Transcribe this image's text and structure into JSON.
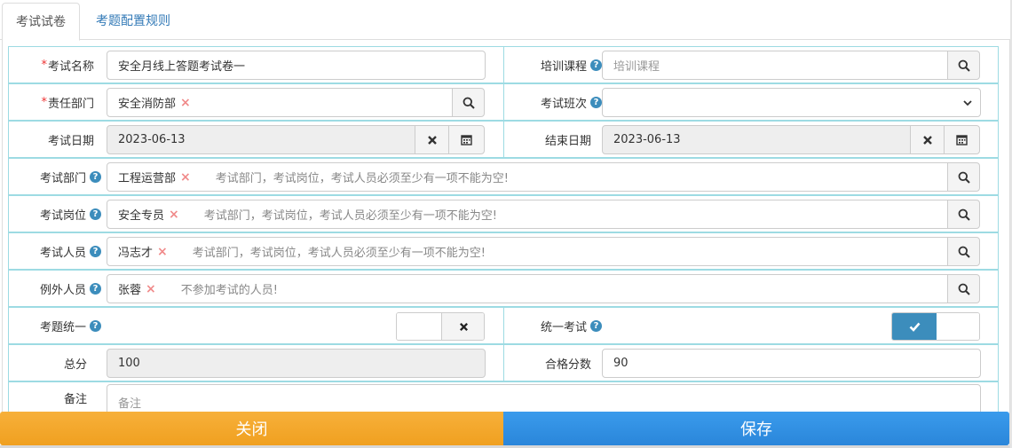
{
  "tabs": [
    {
      "label": "考试试卷"
    },
    {
      "label": "考题配置规则"
    }
  ],
  "form": {
    "exam_name": {
      "required_mark": "*",
      "label": "考试名称",
      "value": "安全月线上答题考试卷一"
    },
    "training_course": {
      "label": "培训课程",
      "placeholder": "培训课程"
    },
    "responsible_dept": {
      "required_mark": "*",
      "label": "责任部门",
      "tag": "安全消防部"
    },
    "exam_session": {
      "label": "考试班次",
      "value": ""
    },
    "exam_date": {
      "label": "考试日期",
      "value": "2023-06-13"
    },
    "end_date": {
      "label": "结束日期",
      "value": "2023-06-13"
    },
    "exam_dept": {
      "label": "考试部门",
      "tag": "工程运营部",
      "hint": "考试部门，考试岗位，考试人员必须至少有一项不能为空!"
    },
    "exam_post": {
      "label": "考试岗位",
      "tag": "安全专员",
      "hint": "考试部门，考试岗位，考试人员必须至少有一项不能为空!"
    },
    "exam_person": {
      "label": "考试人员",
      "tag": "冯志才",
      "hint": "考试部门，考试岗位，考试人员必须至少有一项不能为空!"
    },
    "excluded_person": {
      "label": "例外人员",
      "tag": "张蓉",
      "hint": "不参加考试的人员!"
    },
    "unified_questions": {
      "label": "考题统一",
      "state": "off"
    },
    "unified_exam": {
      "label": "统一考试",
      "state": "on"
    },
    "total_score": {
      "label": "总分",
      "value": "100"
    },
    "passing_score": {
      "label": "合格分数",
      "value": "90"
    },
    "remarks": {
      "label": "备注",
      "placeholder": "备注"
    }
  },
  "buttons": {
    "close": "关闭",
    "save": "保存"
  },
  "icons": {
    "help": "question-circle-icon",
    "search": "search-icon",
    "clear": "times-icon",
    "calendar": "calendar-icon",
    "check": "check-icon",
    "tag_remove": "tag-remove-icon",
    "dropdown": "chevron-down-icon"
  },
  "colors": {
    "required": "#e33333",
    "help_icon": "#3c8dbc",
    "grid_border": "#9ddbe3",
    "toggle_on": "#3c8dbc",
    "close_button": "#f5a623",
    "save_button": "#2e8ee0",
    "tab_link": "#337ab7"
  }
}
